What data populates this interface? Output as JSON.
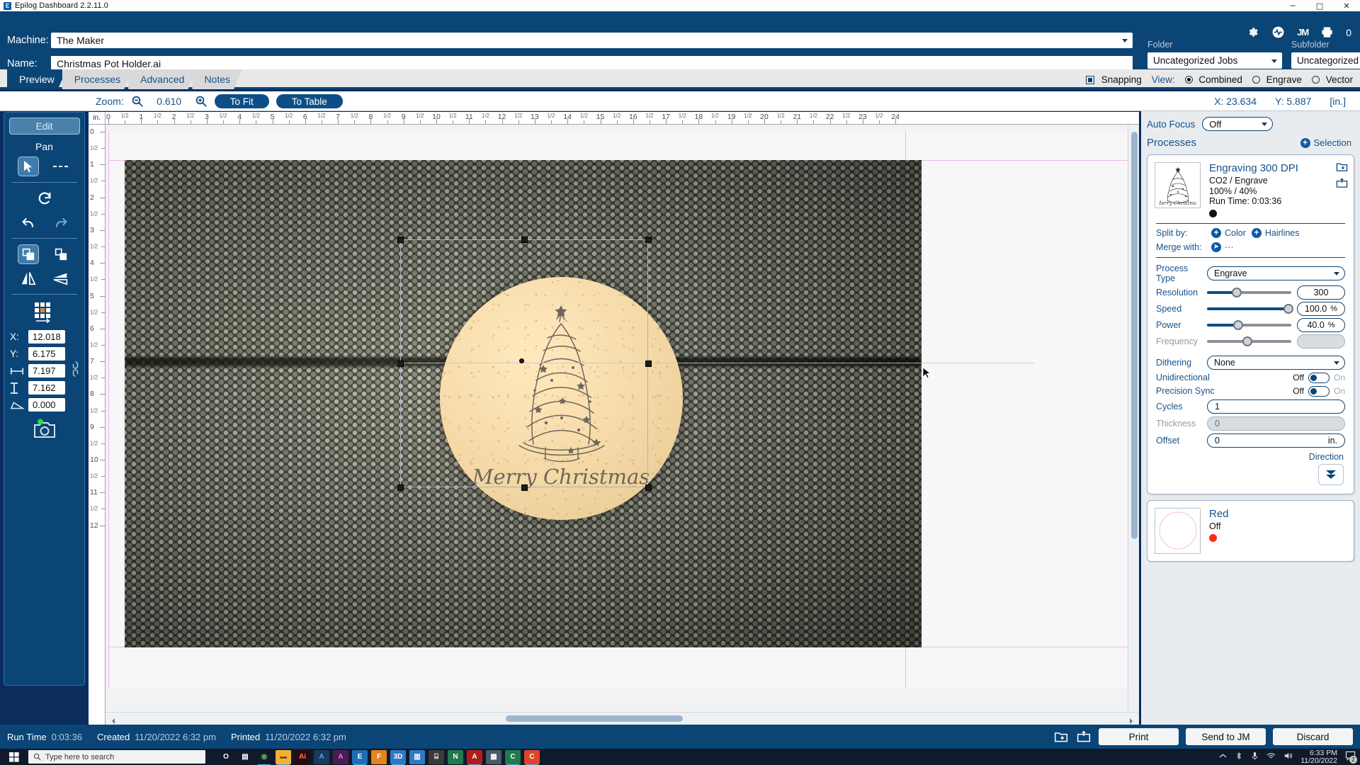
{
  "window": {
    "title": "Epilog Dashboard 2.2.11.0",
    "app_icon": "E",
    "minimize": "─",
    "maximize": "□",
    "close": "✕"
  },
  "header": {
    "machine_label": "Machine:",
    "machine_value": "The Maker",
    "name_label": "Name:",
    "name_value": "Christmas Pot Holder.ai",
    "folder_label": "Folder",
    "folder_value": "Uncategorized Jobs",
    "subfolder_label": "Subfolder",
    "subfolder_value": "Uncategorized Jobs",
    "jm_label": "JM",
    "queue_count": "0"
  },
  "tabs": [
    {
      "label": "Preview",
      "active": true
    },
    {
      "label": "Processes",
      "active": false
    },
    {
      "label": "Advanced",
      "active": false
    },
    {
      "label": "Notes",
      "active": false
    }
  ],
  "viewbar": {
    "snapping_label": "Snapping",
    "snapping_checked": true,
    "view_label": "View:",
    "options": [
      {
        "label": "Combined",
        "selected": true
      },
      {
        "label": "Engrave",
        "selected": false
      },
      {
        "label": "Vector",
        "selected": false
      }
    ]
  },
  "zoombar": {
    "zoom_label": "Zoom:",
    "zoom_value": "0.610",
    "to_fit": "To Fit",
    "to_table": "To Table",
    "x_label": "X:",
    "x_value": "23.634",
    "y_label": "Y:",
    "y_value": "5.887",
    "units": "[in.]"
  },
  "left_tools": {
    "edit_label": "Edit",
    "pan_label": "Pan",
    "x_label": "X:",
    "x_value": "12.018",
    "y_label": "Y:",
    "y_value": "6.175",
    "width_value": "7.197",
    "height_value": "7.162",
    "angle_value": "0.000"
  },
  "ruler": {
    "unit_label": "in.",
    "h_major": [
      0,
      1,
      2,
      3,
      4,
      5,
      6,
      7,
      8,
      9,
      10,
      11,
      12,
      13,
      14,
      15,
      16,
      17,
      18,
      19,
      20,
      21,
      22,
      23,
      24
    ],
    "half_label": "1/2",
    "v_major": [
      0,
      1,
      2,
      3,
      4,
      5,
      6,
      7,
      8,
      9,
      10,
      11,
      12
    ]
  },
  "right_panel": {
    "auto_focus_label": "Auto Focus",
    "auto_focus_value": "Off",
    "processes_label": "Processes",
    "selection_label": "Selection",
    "process": {
      "title": "Engraving 300 DPI",
      "subtitle": "CO2 / Engrave",
      "percents": "100%  /  40%",
      "runtime": "Run Time: 0:03:36",
      "color_hex": "#111111",
      "split_by_label": "Split by:",
      "split_color": "Color",
      "split_hairlines": "Hairlines",
      "merge_label": "Merge with:",
      "merge_value": "···",
      "process_type_label": "Process Type",
      "process_type_value": "Engrave",
      "resolution_label": "Resolution",
      "resolution_value": "300",
      "resolution_pct": 35,
      "speed_label": "Speed",
      "speed_value": "100.0",
      "speed_unit": "%",
      "speed_pct": 97,
      "power_label": "Power",
      "power_value": "40.0",
      "power_unit": "%",
      "power_pct": 37,
      "frequency_label": "Frequency",
      "frequency_value": "",
      "frequency_pct": 48,
      "dithering_label": "Dithering",
      "dithering_value": "None",
      "unidirectional_label": "Unidirectional",
      "unidirectional_off": "Off",
      "unidirectional_on": "On",
      "precision_sync_label": "Precision Sync",
      "precision_sync_off": "Off",
      "precision_sync_on": "On",
      "cycles_label": "Cycles",
      "cycles_value": "1",
      "thickness_label": "Thickness",
      "thickness_value": "0",
      "offset_label": "Offset",
      "offset_value": "0",
      "offset_unit": "in.",
      "direction_label": "Direction"
    },
    "process2": {
      "title": "Red",
      "status": "Off",
      "color_hex": "#ff2a18"
    }
  },
  "artwork": {
    "caption": "Merry Christmas"
  },
  "statusbar": {
    "runtime_label": "Run Time",
    "runtime_value": "0:03:36",
    "created_label": "Created",
    "created_value": "11/20/2022 6:32 pm",
    "printed_label": "Printed",
    "printed_value": "11/20/2022 6:32 pm",
    "print_button": "Print",
    "send_button": "Send to JM",
    "discard_button": "Discard"
  },
  "taskbar": {
    "search_placeholder": "Type here to search",
    "clock_time": "6:33 PM",
    "clock_date": "11/20/2022",
    "notification_count": "2",
    "apps": [
      {
        "name": "cortana",
        "glyph": "O",
        "bg": "transparent",
        "fg": "#ffffff",
        "underline": false
      },
      {
        "name": "task-view",
        "glyph": "▤",
        "bg": "transparent",
        "fg": "#ffffff",
        "underline": false
      },
      {
        "name": "chrome",
        "glyph": "◉",
        "bg": "transparent",
        "fg": "#4caf50",
        "underline": true
      },
      {
        "name": "file-explorer",
        "glyph": "▬",
        "bg": "#f2b134",
        "fg": "#7a5712",
        "underline": true
      },
      {
        "name": "illustrator",
        "glyph": "Ai",
        "bg": "#2b0a0a",
        "fg": "#ff7b5e",
        "underline": false
      },
      {
        "name": "affinity-designer",
        "glyph": "A",
        "bg": "#1b3a5c",
        "fg": "#53a7e8",
        "underline": false
      },
      {
        "name": "affinity-photo",
        "glyph": "A",
        "bg": "#4a1b55",
        "fg": "#d080e8",
        "underline": false
      },
      {
        "name": "epilog-dashboard",
        "glyph": "E",
        "bg": "#1b6fb5",
        "fg": "#ffffff",
        "underline": true
      },
      {
        "name": "fusion360",
        "glyph": "F",
        "bg": "#e8821e",
        "fg": "#ffffff",
        "underline": false
      },
      {
        "name": "3d-builder",
        "glyph": "3D",
        "bg": "#2f79c4",
        "fg": "#ffffff",
        "underline": true
      },
      {
        "name": "sticky-notes",
        "glyph": "▥",
        "bg": "#2f79c4",
        "fg": "#ffffff",
        "underline": false
      },
      {
        "name": "printer-app",
        "glyph": "⌸",
        "bg": "#3a3a3a",
        "fg": "#dddddd",
        "underline": false
      },
      {
        "name": "onenote",
        "glyph": "N",
        "bg": "#1f7a4d",
        "fg": "#ffffff",
        "underline": false
      },
      {
        "name": "acrobat",
        "glyph": "A",
        "bg": "#b31b1b",
        "fg": "#ffffff",
        "underline": true
      },
      {
        "name": "calculator",
        "glyph": "▦",
        "bg": "#4a5a6a",
        "fg": "#ffffff",
        "underline": false
      },
      {
        "name": "corel-draw",
        "glyph": "C",
        "bg": "#1f7a4d",
        "fg": "#ffffff",
        "underline": true
      },
      {
        "name": "corel-photo-paint",
        "glyph": "C",
        "bg": "#e0432a",
        "fg": "#ffffff",
        "underline": true
      }
    ]
  }
}
